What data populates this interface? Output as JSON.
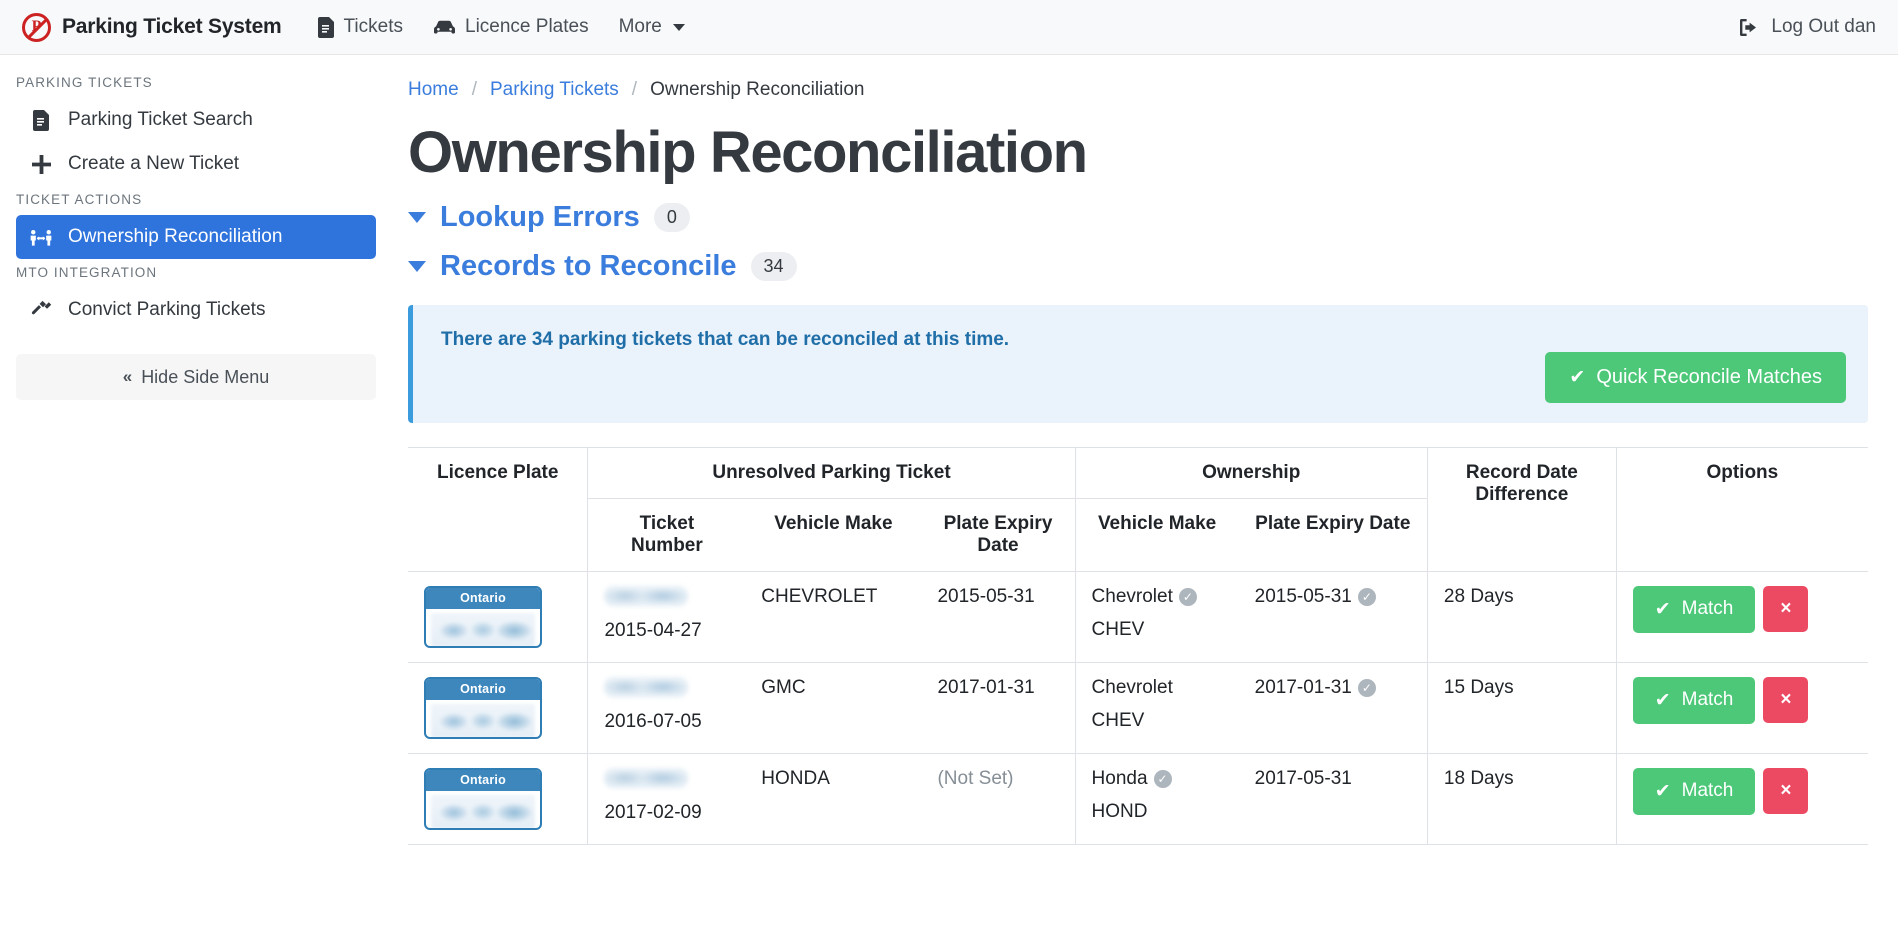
{
  "navbar": {
    "brand": "Parking Ticket System",
    "brand_logo_icon": "no-parking-icon",
    "links": [
      {
        "label": "Tickets",
        "icon": "document-icon"
      },
      {
        "label": "Licence Plates",
        "icon": "car-icon"
      },
      {
        "label": "More",
        "icon": "chevron-down-icon"
      }
    ],
    "logout": {
      "label": "Log Out dan",
      "icon": "logout-icon"
    }
  },
  "sidebar": {
    "groups": [
      {
        "heading": "PARKING TICKETS",
        "items": [
          {
            "label": "Parking Ticket Search",
            "icon": "document-search-icon",
            "active": false
          },
          {
            "label": "Create a New Ticket",
            "icon": "plus-icon",
            "active": false
          }
        ]
      },
      {
        "heading": "TICKET ACTIONS",
        "items": [
          {
            "label": "Ownership Reconciliation",
            "icon": "handshake-icon",
            "active": true
          }
        ]
      },
      {
        "heading": "MTO INTEGRATION",
        "items": [
          {
            "label": "Convict Parking Tickets",
            "icon": "gavel-icon",
            "active": false
          }
        ]
      }
    ],
    "hide_menu": {
      "label": "Hide Side Menu",
      "icon": "double-chevron-left-icon"
    }
  },
  "breadcrumb": [
    {
      "label": "Home",
      "link": true
    },
    {
      "label": "Parking Tickets",
      "link": true
    },
    {
      "label": "Ownership Reconciliation",
      "link": false
    }
  ],
  "page_title": "Ownership Reconciliation",
  "sections": [
    {
      "name": "Lookup Errors",
      "count": "0"
    },
    {
      "name": "Records to Reconcile",
      "count": "34"
    }
  ],
  "alert": {
    "message": "There are 34 parking tickets that can be reconciled at this time.",
    "button": {
      "label": "Quick Reconcile Matches",
      "icon": "check-icon",
      "color": "#4cc878"
    }
  },
  "table": {
    "group_headers": [
      {
        "label": "Licence Plate"
      },
      {
        "label": "Unresolved Parking Ticket"
      },
      {
        "label": "Ownership"
      },
      {
        "label": "Record Date Difference"
      },
      {
        "label": "Options"
      }
    ],
    "sub_headers": [
      {
        "label": "Ticket Number"
      },
      {
        "label": "Vehicle Make"
      },
      {
        "label": "Plate Expiry Date"
      },
      {
        "label": "Vehicle Make"
      },
      {
        "label": "Plate Expiry Date"
      }
    ],
    "rows": [
      {
        "plate_region": "Ontario",
        "plate_number": "",
        "ticket_number": "",
        "ticket_date": "2015-04-27",
        "ticket_vehicle_make": "CHEVROLET",
        "ticket_plate_expiry": "2015-05-31",
        "owner_vehicle_make": "Chevrolet",
        "owner_vehicle_make_verified": true,
        "owner_vehicle_make_code": "CHEV",
        "owner_plate_expiry": "2015-05-31",
        "owner_plate_expiry_verified": true,
        "record_date_difference": "28 Days",
        "match_label": "Match",
        "dismiss_label": "×"
      },
      {
        "plate_region": "Ontario",
        "plate_number": "",
        "ticket_number": "",
        "ticket_date": "2016-07-05",
        "ticket_vehicle_make": "GMC",
        "ticket_plate_expiry": "2017-01-31",
        "owner_vehicle_make": "Chevrolet",
        "owner_vehicle_make_verified": false,
        "owner_vehicle_make_code": "CHEV",
        "owner_plate_expiry": "2017-01-31",
        "owner_plate_expiry_verified": true,
        "record_date_difference": "15 Days",
        "match_label": "Match",
        "dismiss_label": "×"
      },
      {
        "plate_region": "Ontario",
        "plate_number": "",
        "ticket_number": "",
        "ticket_date": "2017-02-09",
        "ticket_vehicle_make": "HONDA",
        "ticket_plate_expiry": "(Not Set)",
        "owner_vehicle_make": "Honda",
        "owner_vehicle_make_verified": true,
        "owner_vehicle_make_code": "HOND",
        "owner_plate_expiry": "2017-05-31",
        "owner_plate_expiry_verified": false,
        "record_date_difference": "18 Days",
        "match_label": "Match",
        "dismiss_label": "×"
      }
    ]
  }
}
